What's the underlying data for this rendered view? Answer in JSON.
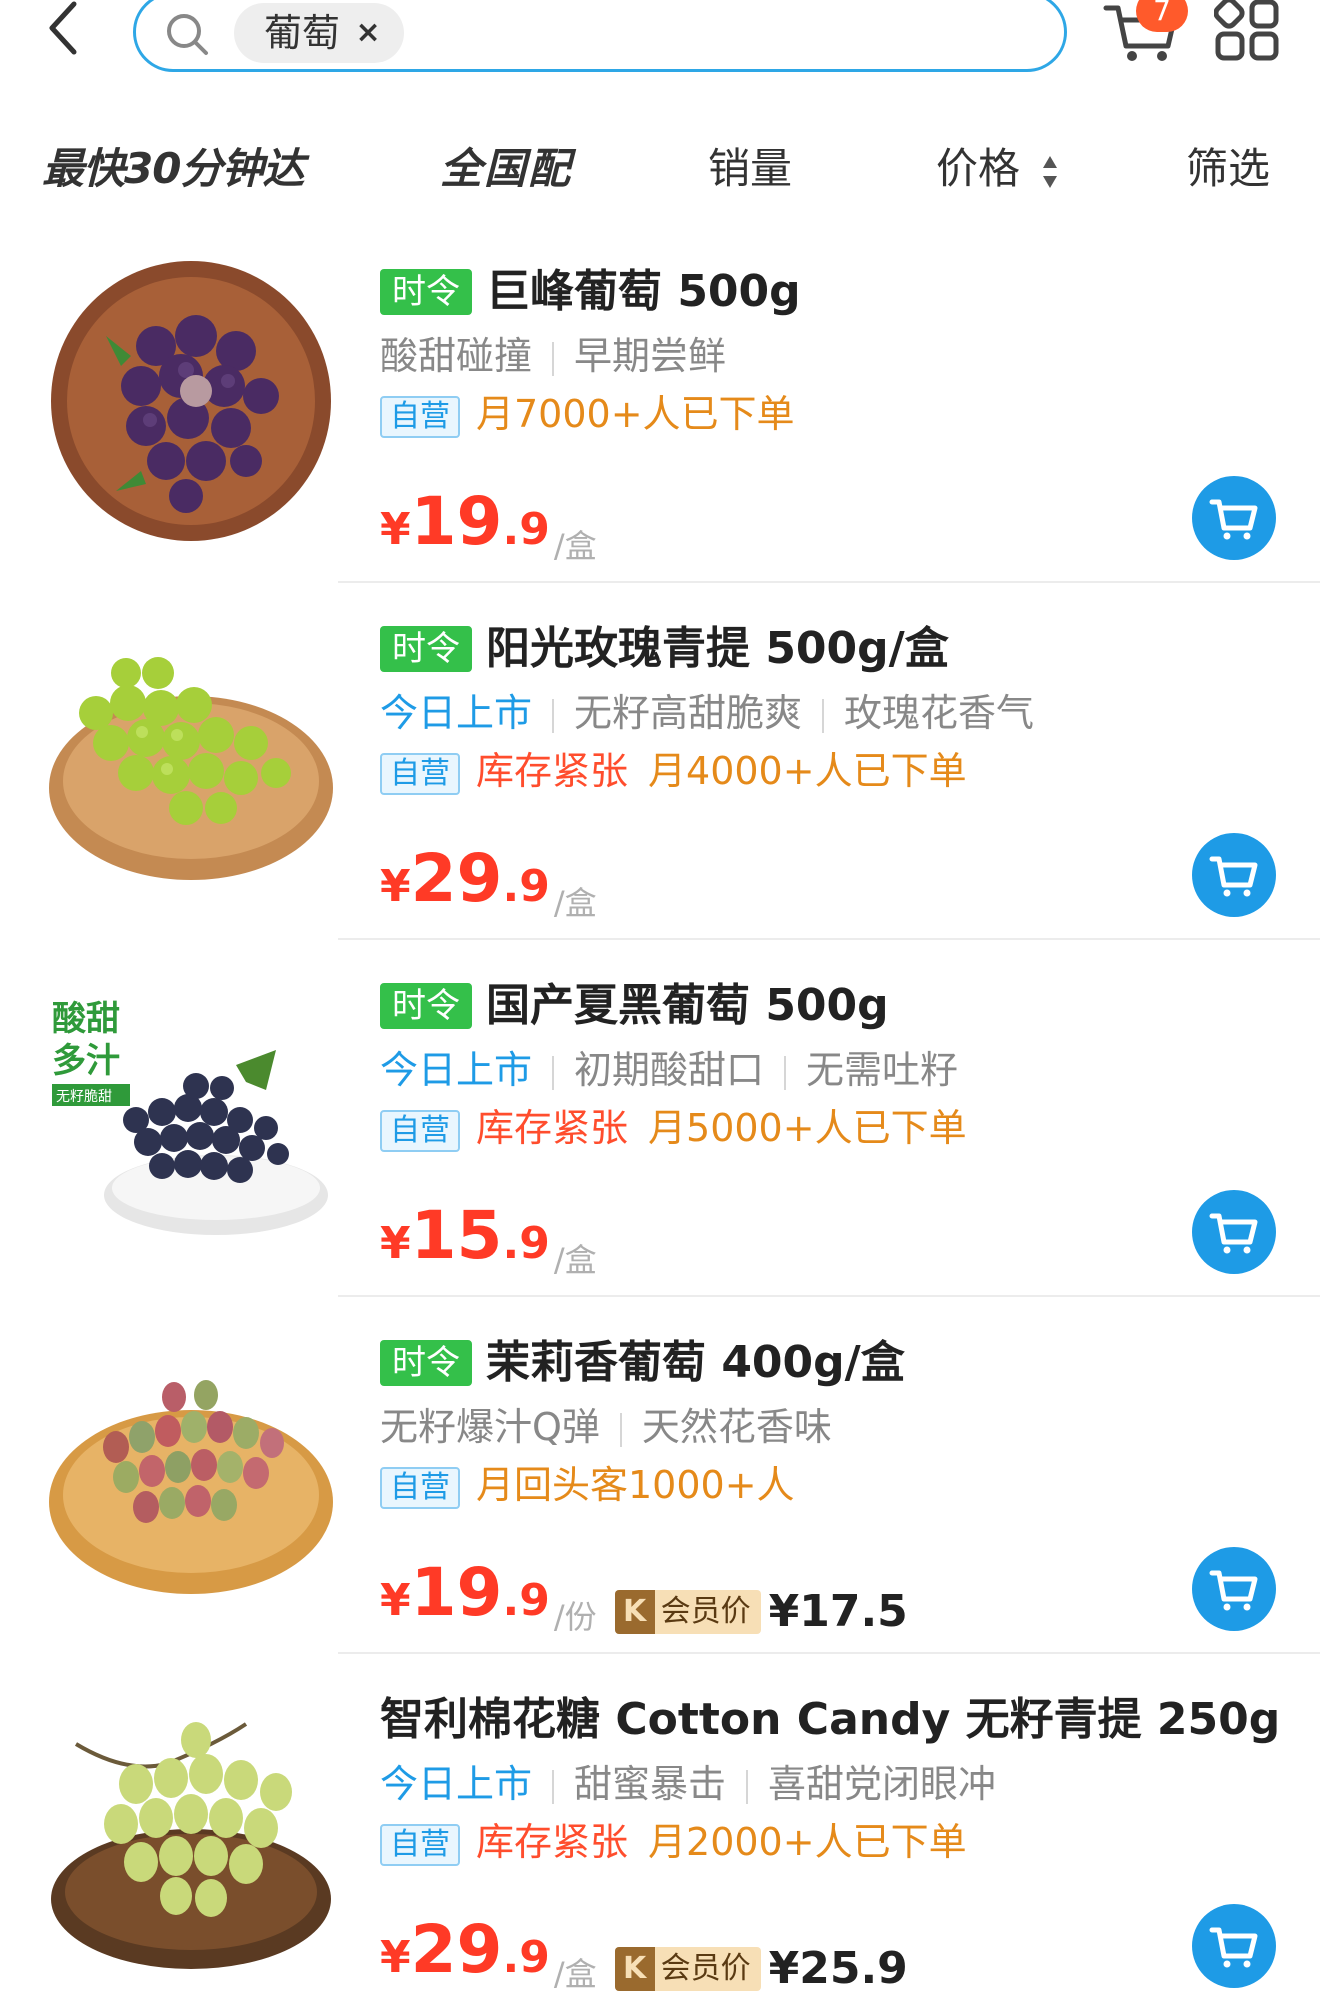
{
  "search": {
    "tag": "葡萄",
    "tag_close": "×"
  },
  "cart": {
    "badge": "7"
  },
  "filters": {
    "fast": "最快30分钟达",
    "nationwide": "全国配",
    "sales": "销量",
    "price": "价格",
    "filter": "筛选"
  },
  "colors": {
    "accent": "#1e9be6",
    "price": "#ff3a26",
    "season": "#34c04a"
  },
  "products": [
    {
      "badge": "时令",
      "title": "巨峰葡萄 500g",
      "tags": [
        "酸甜碰撞",
        "早期尝鲜"
      ],
      "self_label": "自营",
      "stock": "",
      "sold": "月7000+人已下单",
      "yen": "¥",
      "price_int": "19",
      "price_dec": ".9",
      "unit": "/盒",
      "member_label": "",
      "member_price": "",
      "image": "purple-grapes"
    },
    {
      "badge": "时令",
      "title": "阳光玫瑰青提  500g/盒",
      "tags": [
        "今日上市",
        "无籽高甜脆爽",
        "玫瑰花香气"
      ],
      "self_label": "自营",
      "stock": "库存紧张",
      "sold": "月4000+人已下单",
      "yen": "¥",
      "price_int": "29",
      "price_dec": ".9",
      "unit": "/盒",
      "member_label": "",
      "member_price": "",
      "image": "green-grapes"
    },
    {
      "badge": "时令",
      "title": "国产夏黑葡萄 500g",
      "tags": [
        "今日上市",
        "初期酸甜口",
        "无需吐籽"
      ],
      "self_label": "自营",
      "stock": "库存紧张",
      "sold": "月5000+人已下单",
      "yen": "¥",
      "price_int": "15",
      "price_dec": ".9",
      "unit": "/盒",
      "member_label": "",
      "member_price": "",
      "image": "black-grapes",
      "image_text": {
        "line1": "酸甜",
        "line2": "多汁",
        "line3": "无籽脆甜"
      }
    },
    {
      "badge": "时令",
      "title": "茉莉香葡萄  400g/盒",
      "tags": [
        "无籽爆汁Q弹",
        "天然花香味"
      ],
      "self_label": "自营",
      "stock": "",
      "sold": "月回头客1000+人",
      "yen": "¥",
      "price_int": "19",
      "price_dec": ".9",
      "unit": "/份",
      "member_label": "会员价",
      "member_price": "¥17.5",
      "image": "red-green-grapes"
    },
    {
      "badge": "",
      "title": "智利棉花糖 Cotton Candy 无籽青提 250g",
      "tags": [
        "今日上市",
        "甜蜜暴击",
        "喜甜党闭眼冲"
      ],
      "self_label": "自营",
      "stock": "库存紧张",
      "sold": "月2000+人已下单",
      "yen": "¥",
      "price_int": "29",
      "price_dec": ".9",
      "unit": "/盒",
      "member_label": "会员价",
      "member_price": "¥25.9",
      "image": "pale-green-grapes"
    }
  ]
}
